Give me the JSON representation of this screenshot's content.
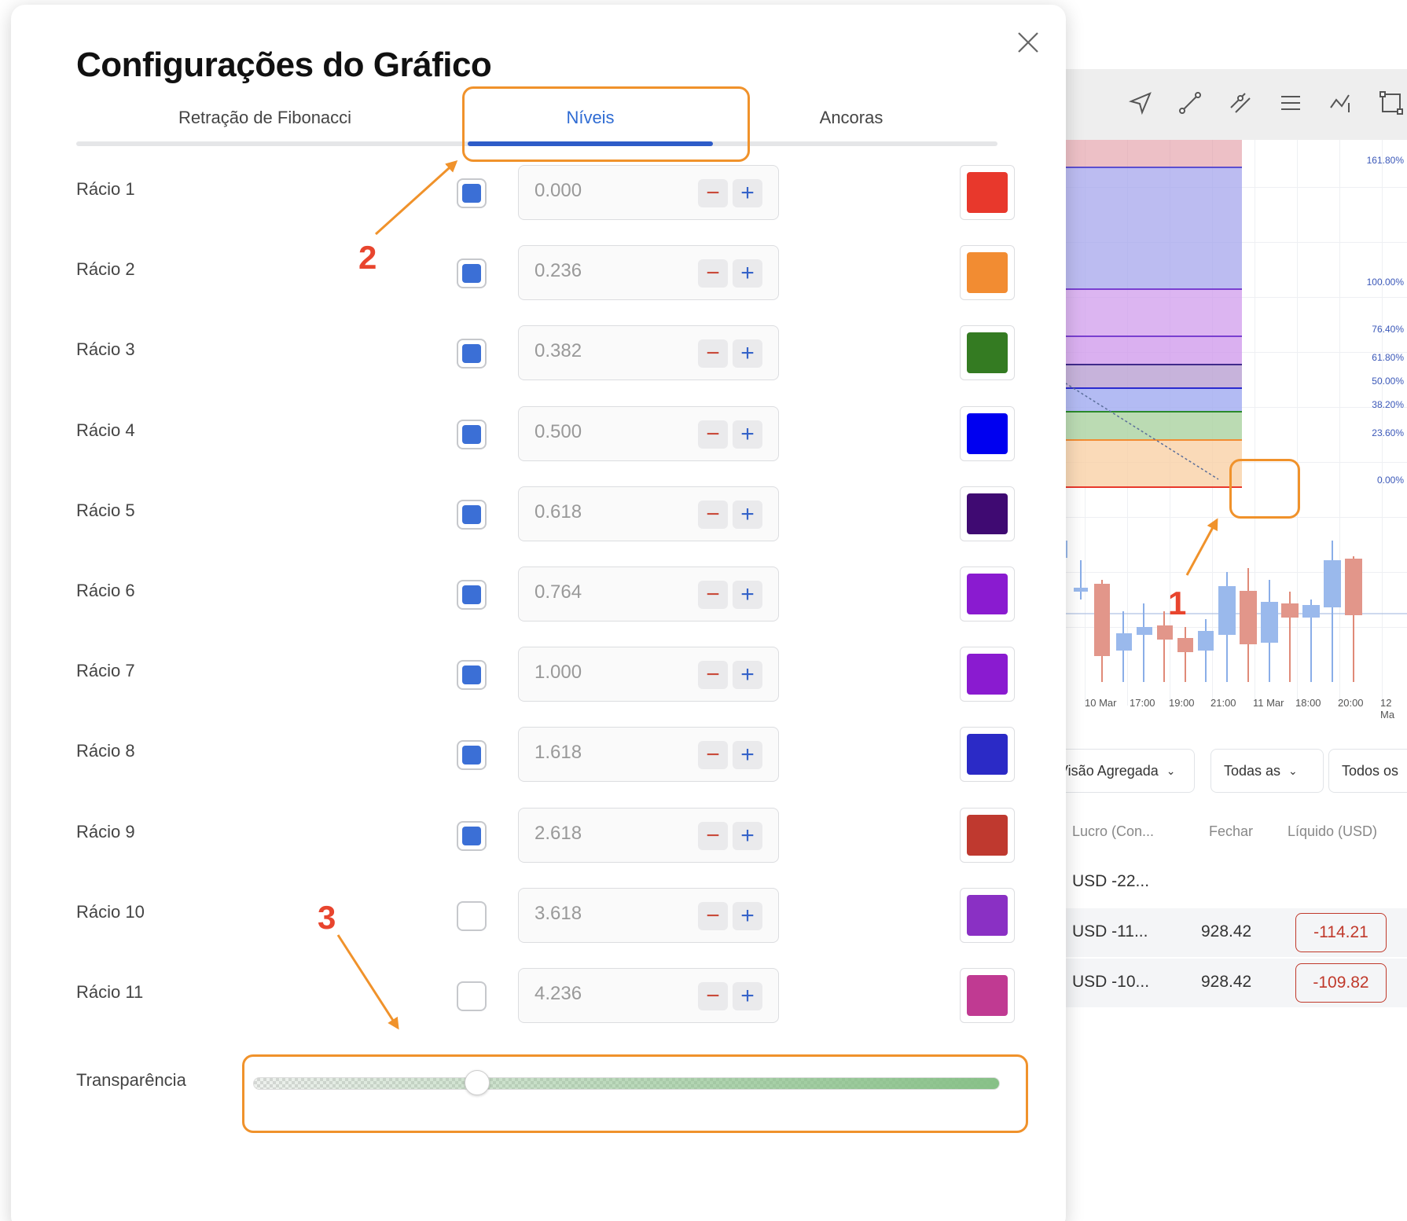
{
  "modal": {
    "title": "Configurações do Gráfico",
    "tabs": [
      {
        "label": "Retração de Fibonacci",
        "active": false
      },
      {
        "label": "Níveis",
        "active": true
      },
      {
        "label": "Ancoras",
        "active": false
      }
    ],
    "levels": [
      {
        "label": "Rácio 1",
        "checked": true,
        "value": "0.000",
        "color": "#e8382c"
      },
      {
        "label": "Rácio 2",
        "checked": true,
        "value": "0.236",
        "color": "#f28c32"
      },
      {
        "label": "Rácio 3",
        "checked": true,
        "value": "0.382",
        "color": "#347b22"
      },
      {
        "label": "Rácio 4",
        "checked": true,
        "value": "0.500",
        "color": "#0000f0"
      },
      {
        "label": "Rácio 5",
        "checked": true,
        "value": "0.618",
        "color": "#3f0a72"
      },
      {
        "label": "Rácio 6",
        "checked": true,
        "value": "0.764",
        "color": "#8a1bd0"
      },
      {
        "label": "Rácio 7",
        "checked": true,
        "value": "1.000",
        "color": "#8a1bd0"
      },
      {
        "label": "Rácio 8",
        "checked": true,
        "value": "1.618",
        "color": "#2b2ac6"
      },
      {
        "label": "Rácio 9",
        "checked": true,
        "value": "2.618",
        "color": "#bf392f"
      },
      {
        "label": "Rácio 10",
        "checked": false,
        "value": "3.618",
        "color": "#8a30c4"
      },
      {
        "label": "Rácio 11",
        "checked": false,
        "value": "4.236",
        "color": "#c03a92"
      }
    ],
    "transparency": {
      "label": "Transparência",
      "value": 0.3
    }
  },
  "chart": {
    "fib_labels": [
      "161.80%",
      "100.00%",
      "76.40%",
      "61.80%",
      "50.00%",
      "38.20%",
      "23.60%",
      "0.00%"
    ],
    "time_labels": [
      "10 Mar",
      "17:00",
      "19:00",
      "21:00",
      "11 Mar",
      "18:00",
      "20:00",
      "12 Ma"
    ]
  },
  "positions": {
    "filters": [
      "Visão Agregada",
      "Todas as",
      "Todos os"
    ],
    "headers": [
      "Lucro (Con...",
      "Fechar",
      "Líquido (USD)"
    ],
    "rows": [
      {
        "profit": "USD -22..."
      },
      {
        "profit": "USD -11...",
        "close": "928.42",
        "net": "-114.21"
      },
      {
        "profit": "USD -10...",
        "close": "928.42",
        "net": "-109.82"
      }
    ]
  },
  "annotations": [
    "1",
    "2",
    "3"
  ],
  "colors": {
    "accent": "#2e6bd3",
    "annotation": "#f0922b",
    "annotation_num": "#e8452e"
  }
}
